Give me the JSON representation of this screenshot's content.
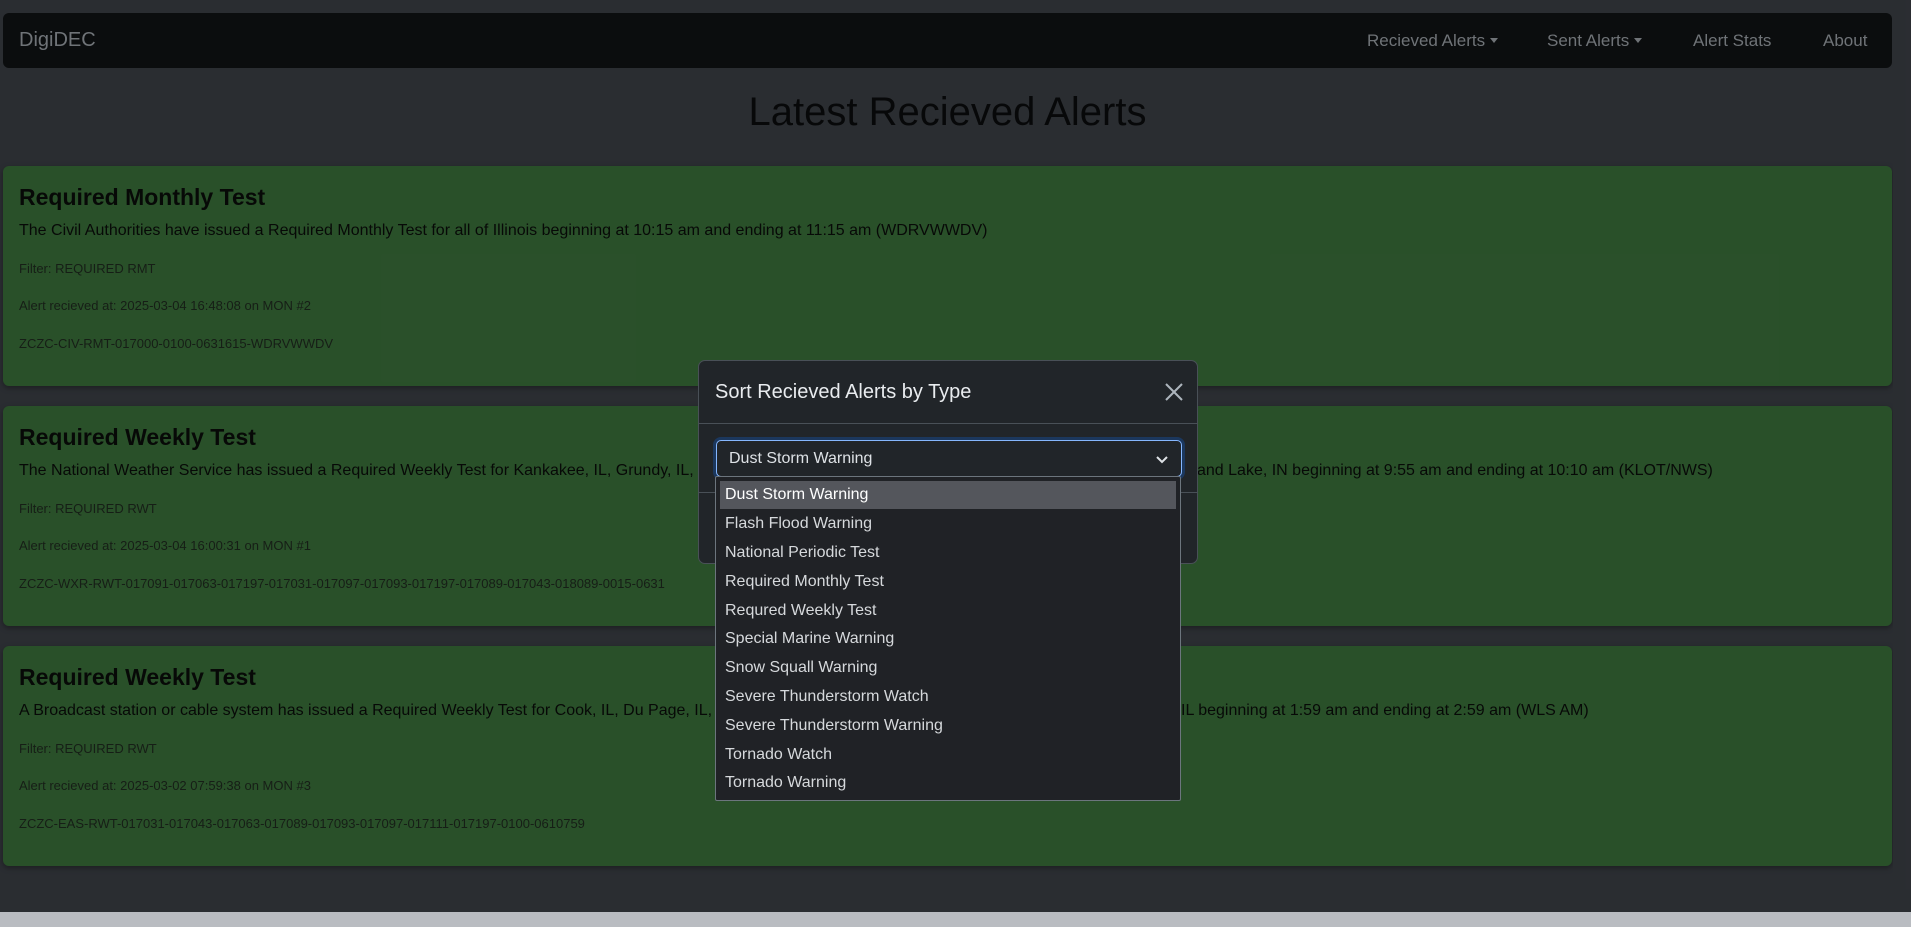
{
  "navbar": {
    "brand": "DigiDEC",
    "items": [
      {
        "label": "Recieved Alerts",
        "dropdown": true
      },
      {
        "label": "Sent Alerts",
        "dropdown": true
      },
      {
        "label": "Alert Stats",
        "dropdown": false
      },
      {
        "label": "About",
        "dropdown": false
      }
    ]
  },
  "page": {
    "heading": "Latest Recieved Alerts"
  },
  "alerts": [
    {
      "title": "Required Monthly Test",
      "text": "The Civil Authorities have issued a Required Monthly Test for all of Illinois beginning at 10:15 am and ending at 11:15 am (WDRVWWDV)",
      "filter": "Filter: REQUIRED RMT",
      "received": "Alert recieved at: 2025-03-04 16:48:08 on MON #2",
      "header": "ZCZC-CIV-RMT-017000-0100-0631615-WDRVWWDV"
    },
    {
      "title": "Required Weekly Test",
      "text": "The National Weather Service has issued a Required Weekly Test for Kankakee, IL, Grundy, IL,",
      "text_right": "and Lake, IN beginning at 9:55 am and ending at 10:10 am (KLOT/NWS)",
      "filter": "Filter: REQUIRED RWT",
      "received": "Alert recieved at: 2025-03-04 16:00:31 on MON #1",
      "header": "ZCZC-WXR-RWT-017091-017063-017197-017031-017097-017093-017197-017089-017043-018089-0015-0631"
    },
    {
      "title": "Required Weekly Test",
      "text": "A Broadcast station or cable system has issued a Required Weekly Test for Cook, IL, Du Page, IL,",
      "text_right": "IL beginning at 1:59 am and ending at 2:59 am (WLS AM)",
      "filter": "Filter: REQUIRED RWT",
      "received": "Alert recieved at: 2025-03-02 07:59:38 on MON #3",
      "header": "ZCZC-EAS-RWT-017031-017043-017063-017089-017093-017097-017111-017197-0100-0610759"
    }
  ],
  "modal": {
    "title": "Sort Recieved Alerts by Type",
    "close_icon": "close-icon",
    "select": {
      "value": "Dust Storm Warning",
      "options": [
        "Dust Storm Warning",
        "Flash Flood Warning",
        "National Periodic Test",
        "Required Monthly Test",
        "Requred Weekly Test",
        "Special Marine Warning",
        "Snow Squall Warning",
        "Severe Thunderstorm Watch",
        "Severe Thunderstorm Warning",
        "Tornado Watch",
        "Tornado Warning"
      ],
      "selected_index": 0
    }
  },
  "colors": {
    "card_bg": "#3a6f3a",
    "navbar_bg": "#101214",
    "page_bg": "#3b3f45",
    "modal_bg": "#212529",
    "focus_border": "#86b7fe"
  }
}
